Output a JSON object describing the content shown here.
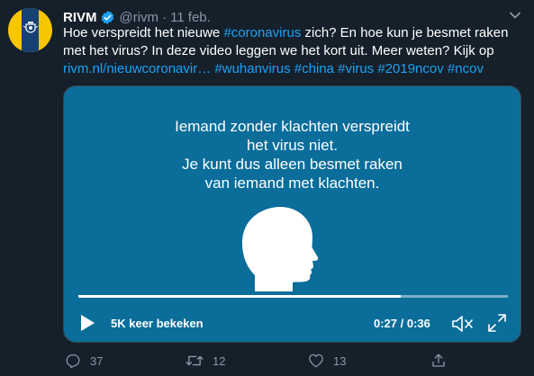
{
  "tweet": {
    "name": "RIVM",
    "handle": "@rivm",
    "separator": "·",
    "date": "11 feb.",
    "text_parts": [
      {
        "text": "Hoe verspreidt het nieuwe ",
        "link": false
      },
      {
        "text": "#coronavirus",
        "link": true
      },
      {
        "text": " zich? En hoe kun je besmet raken met het virus? In deze video leggen we het kort uit. Meer weten? Kijk op ",
        "link": false
      },
      {
        "text": "rivm.nl/nieuwcoronavir…",
        "link": true
      },
      {
        "text": " ",
        "link": false
      },
      {
        "text": "#wuhanvirus",
        "link": true
      },
      {
        "text": " ",
        "link": false
      },
      {
        "text": "#china",
        "link": true
      },
      {
        "text": " ",
        "link": false
      },
      {
        "text": "#virus",
        "link": true
      },
      {
        "text": " ",
        "link": false
      },
      {
        "text": "#2019ncov",
        "link": true
      },
      {
        "text": " ",
        "link": false
      },
      {
        "text": "#ncov",
        "link": true
      }
    ]
  },
  "video": {
    "caption_lines": [
      "Iemand zonder klachten verspreidt",
      "het virus niet.",
      "Je kunt dus alleen besmet raken",
      "van iemand met klachten."
    ],
    "views": "5K keer bekeken",
    "time": "0:27 / 0:36",
    "progress_fraction": 0.75,
    "background_color": "#0a6d9a"
  },
  "actions": {
    "replies": "37",
    "retweets": "12",
    "likes": "13"
  },
  "colors": {
    "background": "#15202b",
    "link": "#1da1f2",
    "muted": "#8899a6",
    "verified": "#1da1f2"
  },
  "icons": [
    "verified-badge-icon",
    "chevron-down-icon",
    "play-icon",
    "mute-icon",
    "fullscreen-icon",
    "reply-icon",
    "retweet-icon",
    "like-icon",
    "share-icon"
  ]
}
